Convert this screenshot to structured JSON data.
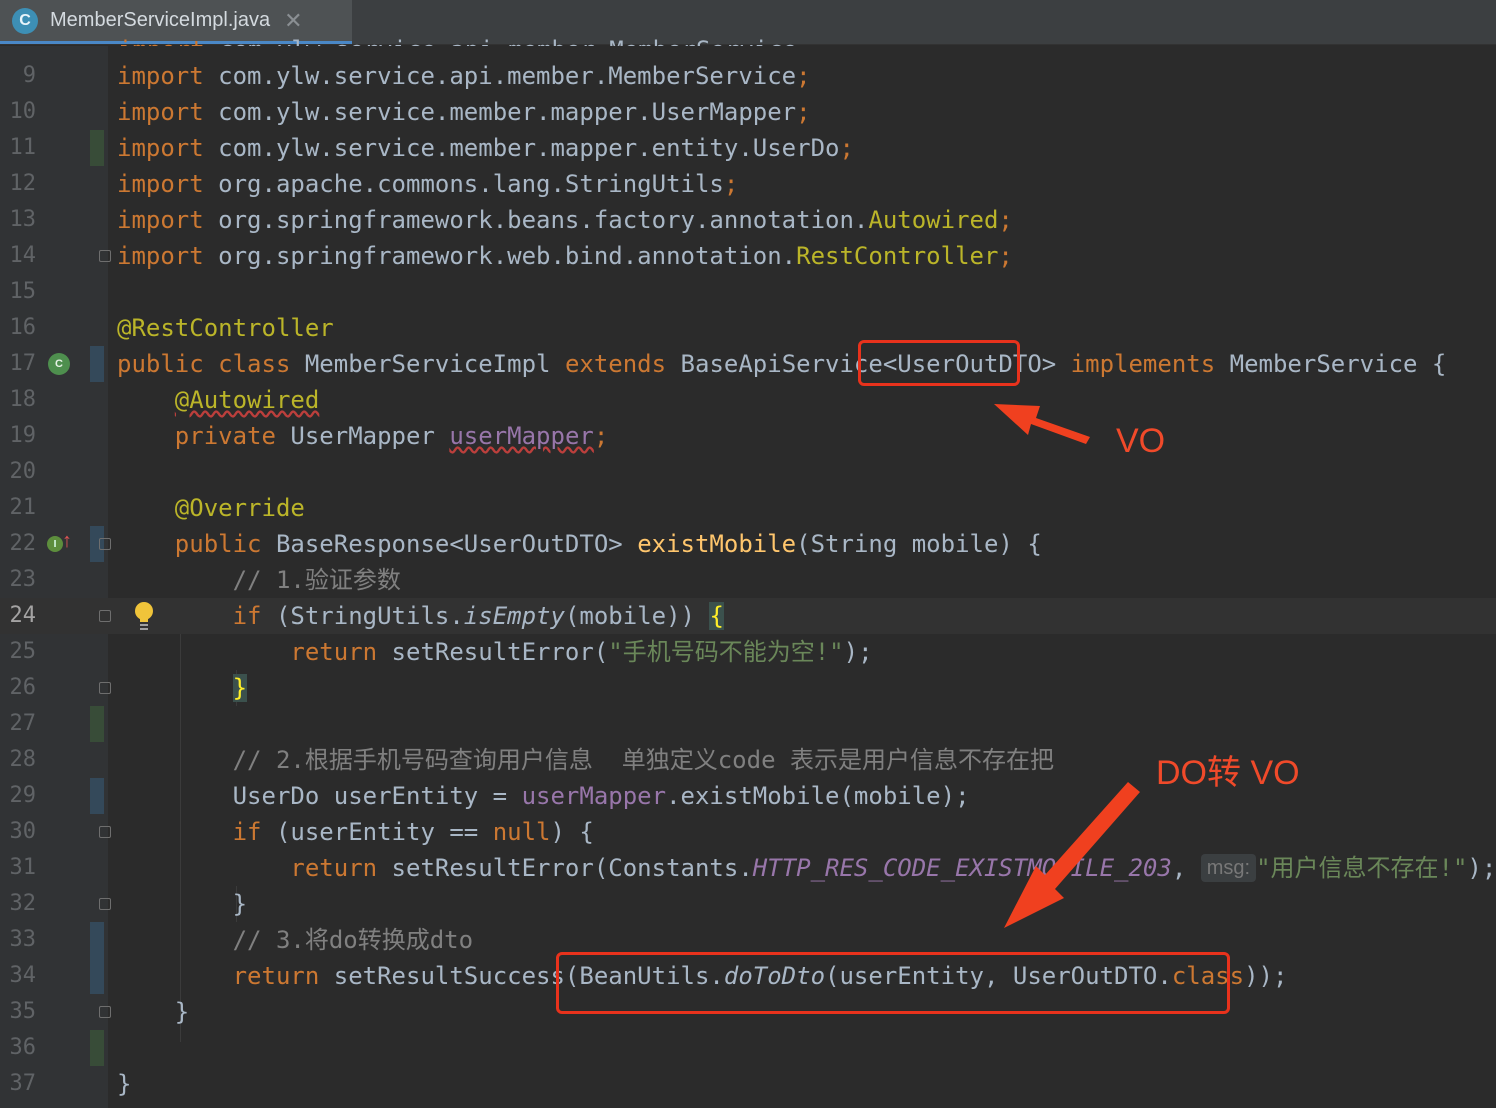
{
  "tab": {
    "icon_letter": "C",
    "title": "MemberServiceImpl.java",
    "close_glyph": "✕"
  },
  "lines": [
    {
      "n": "9"
    },
    {
      "n": "10"
    },
    {
      "n": "11"
    },
    {
      "n": "12"
    },
    {
      "n": "13"
    },
    {
      "n": "14"
    },
    {
      "n": "15"
    },
    {
      "n": "16"
    },
    {
      "n": "17"
    },
    {
      "n": "18"
    },
    {
      "n": "19"
    },
    {
      "n": "20"
    },
    {
      "n": "21"
    },
    {
      "n": "22"
    },
    {
      "n": "23"
    },
    {
      "n": "24"
    },
    {
      "n": "25"
    },
    {
      "n": "26"
    },
    {
      "n": "27"
    },
    {
      "n": "28"
    },
    {
      "n": "29"
    },
    {
      "n": "30"
    },
    {
      "n": "31"
    },
    {
      "n": "32"
    },
    {
      "n": "33"
    },
    {
      "n": "34"
    },
    {
      "n": "35"
    },
    {
      "n": "36"
    },
    {
      "n": "37"
    }
  ],
  "code": {
    "import_kw": "import",
    "imp1": " com.ylw.service.api.member.MemberService",
    "imp2": " com.ylw.service.member.mapper.UserMapper",
    "imp3": " com.ylw.service.member.mapper.entity.UserDo",
    "imp4": " org.apache.commons.lang.StringUtils",
    "imp5_pkg": " org.springframework.beans.factory.annotation.",
    "imp5_cls": "Autowired",
    "imp6_pkg": " org.springframework.web.bind.annotation.",
    "imp6_cls": "RestController",
    "semi": ";",
    "rest_controller": "@RestController",
    "l17_kw1": "public class",
    "l17_name": " MemberServiceImpl ",
    "l17_kw2": "extends",
    "l17_base": " BaseApiService<UserOutDTO> ",
    "l17_kw3": "implements",
    "l17_iface": " MemberService {",
    "autowired": "@Autowired",
    "l19_kw": "private",
    "l19_type": " UserMapper ",
    "l19_field": "userMapper",
    "override": "@Override",
    "l22_kw": "public",
    "l22_type": " BaseResponse<UserOutDTO> ",
    "l22_fn": "existMobile",
    "l22_params": "(String mobile) {",
    "l23_comment": "// 1.验证参数",
    "l24_kw": "if",
    "l24_a": " (StringUtils.",
    "l24_method": "isEmpty",
    "l24_b": "(mobile)) ",
    "l24_brace": "{",
    "l25_kw": "return",
    "l25_a": " setResultError(",
    "l25_str": "\"手机号码不能为空!\"",
    "l25_b": ");",
    "close_brace": "}",
    "l28_comment": "// 2.根据手机号码查询用户信息  单独定义code 表示是用户信息不存在把",
    "l29_a": "UserDo userEntity = ",
    "l29_field": "userMapper",
    "l29_b": ".existMobile(mobile);",
    "l30_kw": "if",
    "l30_a": " (userEntity == ",
    "l30_null": "null",
    "l30_b": ") {",
    "l31_kw": "return",
    "l31_a": " setResultError(Constants.",
    "l31_const": "HTTP_RES_CODE_EXISTMOBILE_203",
    "l31_comma": ", ",
    "l31_hint": "msg:",
    "l31_str": "\"用户信息不存在!\"",
    "l31_b": ");",
    "l33_comment": "// 3.将do转换成dto",
    "l34_kw": "return",
    "l34_a": " setResultSuccess(BeanUtils.",
    "l34_method": "doToDto",
    "l34_b": "(userEntity, UserOutDTO.",
    "l34_class": "class",
    "l34_c": "));",
    "class_close": "}"
  },
  "annotations": {
    "vo_label": "VO",
    "do_to_vo_label": "DO转 VO",
    "color": "#e8321c"
  },
  "colors": {
    "background": "#2b2b2b",
    "keyword": "#cc7832",
    "annotation": "#bbb529",
    "comment": "#808080",
    "string": "#6a8759",
    "field": "#9876aa",
    "method_decl": "#ffc66d",
    "text": "#a9b7c6"
  }
}
